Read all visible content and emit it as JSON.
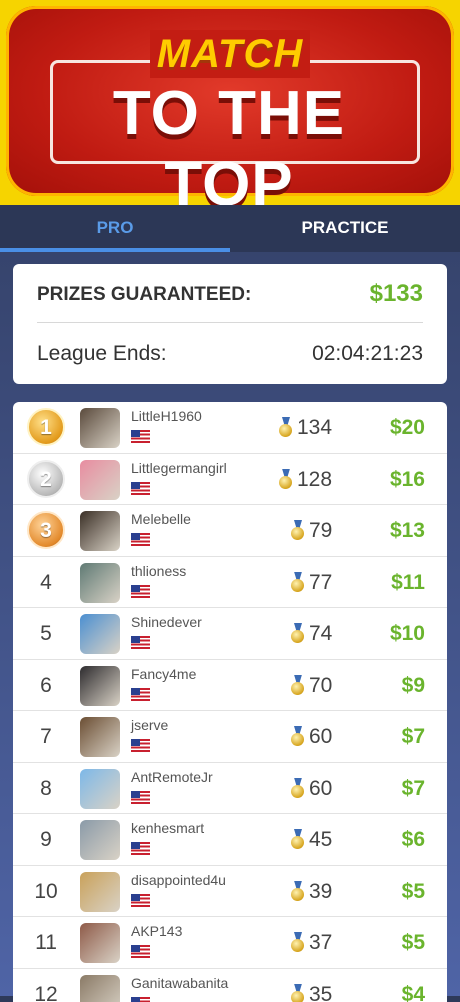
{
  "header": {
    "match": "MATCH",
    "title": "TO THE TOP"
  },
  "tabs": [
    {
      "label": "PRO",
      "active": true
    },
    {
      "label": "PRACTICE",
      "active": false
    }
  ],
  "prizes": {
    "label": "PRIZES GUARANTEED:",
    "value": "$133",
    "league_label": "League Ends:",
    "league_value": "02:04:21:23"
  },
  "leaderboard": [
    {
      "rank": "1",
      "medal": "gold",
      "medal_label": "1",
      "name": "LittleH1960",
      "score": "134",
      "prize": "$20",
      "avatar_color": "#5a4a3c"
    },
    {
      "rank": "2",
      "medal": "silver",
      "medal_label": "2",
      "name": "Littlegermangirl",
      "score": "128",
      "prize": "$16",
      "avatar_color": "#e88ca0"
    },
    {
      "rank": "3",
      "medal": "bronze",
      "medal_label": "3",
      "name": "Melebelle",
      "score": "79",
      "prize": "$13",
      "avatar_color": "#3a2f26"
    },
    {
      "rank": "4",
      "medal": "",
      "medal_label": "",
      "name": "thlioness",
      "score": "77",
      "prize": "$11",
      "avatar_color": "#5f7a74"
    },
    {
      "rank": "5",
      "medal": "",
      "medal_label": "",
      "name": "Shinedever",
      "score": "74",
      "prize": "$10",
      "avatar_color": "#4b8fd1"
    },
    {
      "rank": "6",
      "medal": "",
      "medal_label": "",
      "name": "Fancy4me",
      "score": "70",
      "prize": "$9",
      "avatar_color": "#2d2b2e"
    },
    {
      "rank": "7",
      "medal": "",
      "medal_label": "",
      "name": "jserve",
      "score": "60",
      "prize": "$7",
      "avatar_color": "#6b4e33"
    },
    {
      "rank": "8",
      "medal": "",
      "medal_label": "",
      "name": "AntRemoteJr",
      "score": "60",
      "prize": "$7",
      "avatar_color": "#7db8e8"
    },
    {
      "rank": "9",
      "medal": "",
      "medal_label": "",
      "name": "kenhesmart",
      "score": "45",
      "prize": "$6",
      "avatar_color": "#8a9aa8"
    },
    {
      "rank": "10",
      "medal": "",
      "medal_label": "",
      "name": "disappointed4u",
      "score": "39",
      "prize": "$5",
      "avatar_color": "#c9a15a"
    },
    {
      "rank": "11",
      "medal": "",
      "medal_label": "",
      "name": "AKP143",
      "score": "37",
      "prize": "$5",
      "avatar_color": "#8e5a48"
    },
    {
      "rank": "12",
      "medal": "",
      "medal_label": "",
      "name": "Ganitawabanita",
      "score": "35",
      "prize": "$4",
      "avatar_color": "#8a7a66"
    }
  ],
  "colors": {
    "accent_blue": "#4a8fe6",
    "prize_green": "#6ab42d",
    "banner_red": "#c01b12",
    "banner_yellow": "#f6d400"
  }
}
